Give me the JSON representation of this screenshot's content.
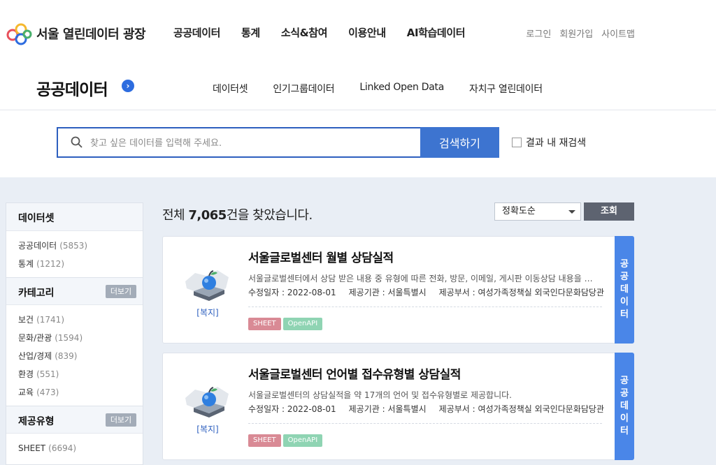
{
  "header": {
    "site_title": "서울 열린데이터 광장",
    "gnb": [
      "공공데이터",
      "통계",
      "소식&참여",
      "이용안내",
      "AI학습데이터"
    ],
    "util": [
      "로그인",
      "회원가입",
      "사이트맵"
    ]
  },
  "section": {
    "title": "공공데이터",
    "tabs": [
      "데이터셋",
      "인기그룹데이터",
      "Linked Open Data",
      "자치구 열린데이터"
    ]
  },
  "search": {
    "placeholder": "찾고 싶은 데이터를 입력해 주세요.",
    "button_label": "검색하기",
    "recheck_label": "결과 내 재검색"
  },
  "sidebar": {
    "dataset": {
      "title": "데이터셋",
      "items": [
        {
          "label": "공공데이터",
          "count": "(5853)"
        },
        {
          "label": "통계",
          "count": "(1212)"
        }
      ]
    },
    "category": {
      "title": "카테고리",
      "more_label": "더보기",
      "items": [
        {
          "label": "보건",
          "count": "(1741)"
        },
        {
          "label": "문화/관광",
          "count": "(1594)"
        },
        {
          "label": "산업/경제",
          "count": "(839)"
        },
        {
          "label": "환경",
          "count": "(551)"
        },
        {
          "label": "교육",
          "count": "(473)"
        }
      ]
    },
    "type": {
      "title": "제공유형",
      "more_label": "더보기",
      "items": [
        {
          "label": "SHEET",
          "count": "(6694)"
        }
      ]
    }
  },
  "results": {
    "count_prefix": "전체",
    "count_value": "7,065",
    "count_suffix": "건을 찾았습니다.",
    "sort_selected": "정확도순",
    "query_label": "조회",
    "items": [
      {
        "category": "[복지]",
        "title": "서울글로벌센터 월별 상담실적",
        "description": "서울글로벌센터에서 상담 받은 내용 중 유형에 따른 전화, 방문, 이메일, 게시판 이동상담 내용을 월...",
        "date_label": "수정일자 :",
        "date": "2022-08-01",
        "org_label": "제공기관 :",
        "org": "서울특별시",
        "dept_label": "제공부서 :",
        "dept": "여성가족정책실 외국인다문화담당관",
        "tags": [
          "SHEET",
          "OpenAPI"
        ],
        "side_tab": [
          "공",
          "공",
          "데",
          "이",
          "터"
        ]
      },
      {
        "category": "[복지]",
        "title": "서울글로벌센터 언어별 접수유형별 상담실적",
        "description": "서울글로벌센터의 상담실적을 약 17개의 언어 및 접수유형별로 제공합니다.",
        "date_label": "수정일자 :",
        "date": "2022-08-01",
        "org_label": "제공기관 :",
        "org": "서울특별시",
        "dept_label": "제공부서 :",
        "dept": "여성가족정책실 외국인다문화담당관",
        "tags": [
          "SHEET",
          "OpenAPI"
        ],
        "side_tab": [
          "공",
          "공",
          "데",
          "이",
          "터"
        ]
      }
    ]
  },
  "colors": {
    "primary": "#3d74d0",
    "side_tab": "#4a86e8",
    "tag_sheet": "#d98a95",
    "tag_api": "#8fd4b3"
  }
}
